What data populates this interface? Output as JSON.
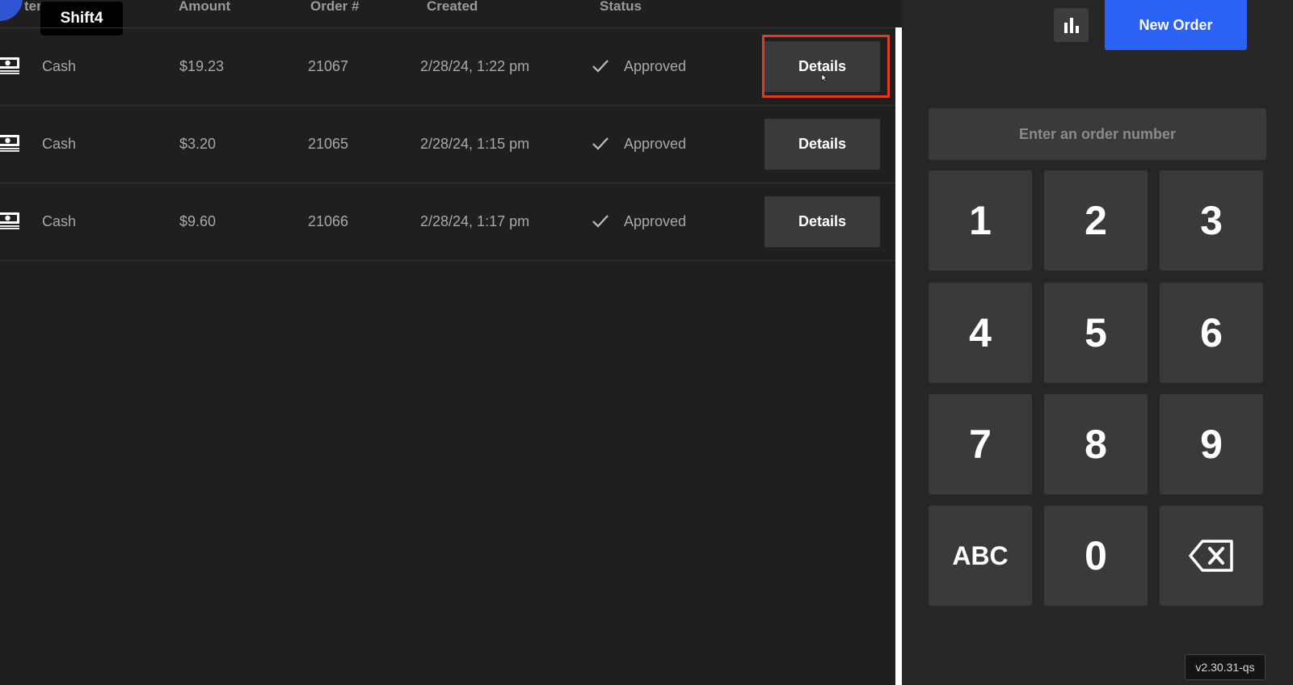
{
  "brand": {
    "badge": "Shift4",
    "accent": "#2a62f6"
  },
  "table": {
    "columns": [
      {
        "key": "tender",
        "label": "ter"
      },
      {
        "key": "amount",
        "label": "Amount"
      },
      {
        "key": "order",
        "label": "Order #"
      },
      {
        "key": "created",
        "label": "Created"
      },
      {
        "key": "status",
        "label": "Status"
      }
    ],
    "rows": [
      {
        "tender": "Cash",
        "amount": "$19.23",
        "order": "21067",
        "created": "2/28/24, 1:22 pm",
        "status": "Approved",
        "action": "Details",
        "highlighted": true
      },
      {
        "tender": "Cash",
        "amount": "$3.20",
        "order": "21065",
        "created": "2/28/24, 1:15 pm",
        "status": "Approved",
        "action": "Details"
      },
      {
        "tender": "Cash",
        "amount": "$9.60",
        "order": "21066",
        "created": "2/28/24, 1:17 pm",
        "status": "Approved",
        "action": "Details"
      }
    ],
    "tender_icon": "cash-icon",
    "status_icon": "check-icon"
  },
  "toolbar": {
    "stats_icon": "bar-chart-icon",
    "new_order_label": "New Order"
  },
  "keypad": {
    "input_placeholder": "Enter an order number",
    "input_value": "",
    "keys": [
      "1",
      "2",
      "3",
      "4",
      "5",
      "6",
      "7",
      "8",
      "9",
      "ABC",
      "0",
      "backspace-icon"
    ]
  },
  "version": "v2.30.31-qs"
}
